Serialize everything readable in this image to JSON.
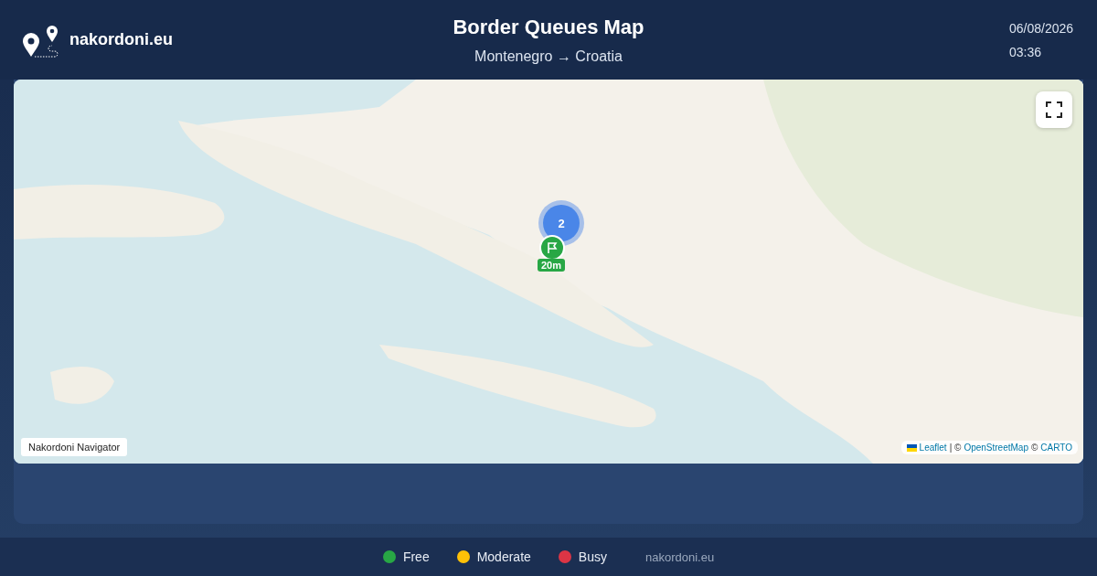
{
  "header": {
    "brand": "nakordoni.eu",
    "title": "Border Queues Map",
    "route": "Montenegro → Croatia",
    "date": "06/08/2026",
    "time": "03:36"
  },
  "map": {
    "cluster": {
      "count": "2"
    },
    "markers": [
      {
        "label": "20m",
        "color": "#28a745"
      }
    ],
    "badge": "Nakordoni Navigator",
    "attribution": {
      "leaflet": "Leaflet",
      "separator": "| ©",
      "osm": "OpenStreetMap",
      "copy": "©",
      "carto": "CARTO"
    }
  },
  "legend": [
    {
      "label": "Free",
      "color": "#28a745"
    },
    {
      "label": "Moderate",
      "color": "#ffc107"
    },
    {
      "label": "Busy",
      "color": "#dc3545"
    }
  ],
  "footer": {
    "site": "nakordoni.eu"
  }
}
